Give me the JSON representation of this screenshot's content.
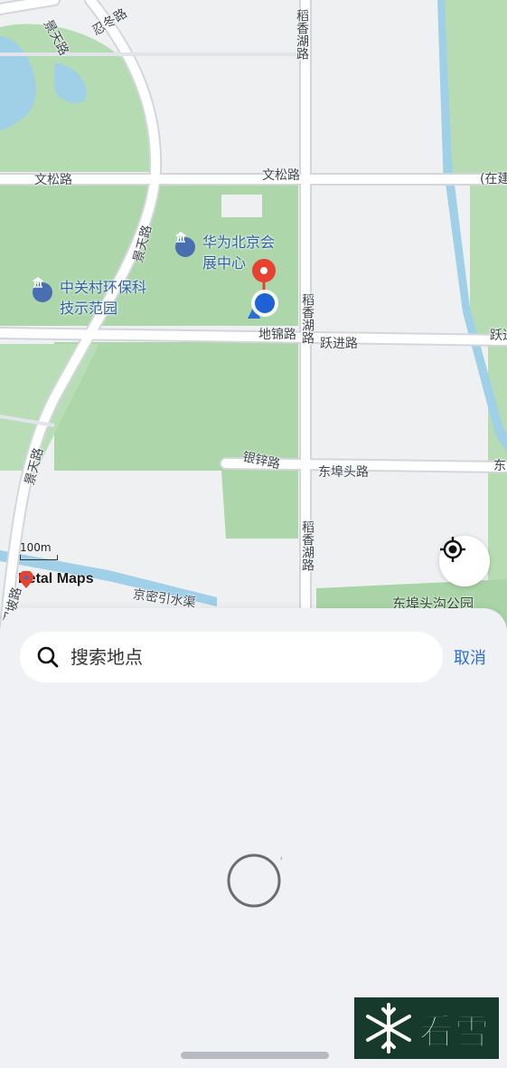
{
  "map": {
    "road_labels": {
      "jingtian_top": "景天路",
      "rendong": "忍冬路",
      "daoxiang_top": "稻香湖路",
      "wensong_left": "文松路",
      "wensong_right": "文松路",
      "zaijian": "(在建",
      "jingtian_mid": "景天路",
      "daoxiang_mid": "稻香湖路",
      "dijin": "地锦路",
      "yuejin": "跃进路",
      "yuejin_right": "跃进",
      "jingtian_low": "景天路",
      "yinban": "银锌路",
      "dongbutou": "东埠头路",
      "dong_right": "东",
      "daoxiang_low": "稻香湖路",
      "jingmi": "京密引水渠",
      "shuangpo": "双坡路"
    },
    "pois": {
      "huawei": "华为北京会展中心",
      "zhongguancun": "中关村环保科技示范园",
      "park": "东埠头沟公园"
    },
    "scale_label": "100m",
    "brand": "Petal Maps",
    "colors": {
      "park": "#a9d4a7",
      "water": "#9fd0e8",
      "road": "#ffffff",
      "road_edge": "#d6dadf",
      "pin_red": "#e8412f",
      "location_blue": "#1f62d8"
    }
  },
  "panel": {
    "search_placeholder": "搜索地点",
    "cancel_label": "取消"
  },
  "watermark": {
    "text": "看雪"
  }
}
